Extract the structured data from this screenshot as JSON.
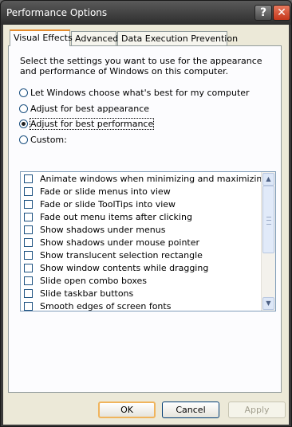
{
  "window": {
    "title": "Performance Options"
  },
  "tabs": [
    "Visual Effects",
    "Advanced",
    "Data Execution Prevention"
  ],
  "description": "Select the settings you want to use for the appearance and performance of Windows on this computer.",
  "options": [
    {
      "label": "Let Windows choose what's best for my computer",
      "checked": false
    },
    {
      "label": "Adjust for best appearance",
      "checked": false
    },
    {
      "label": "Adjust for best performance",
      "checked": true
    },
    {
      "label": "Custom:",
      "checked": false
    }
  ],
  "effects": [
    "Animate windows when minimizing and maximizing",
    "Fade or slide menus into view",
    "Fade or slide ToolTips into view",
    "Fade out menu items after clicking",
    "Show shadows under menus",
    "Show shadows under mouse pointer",
    "Show translucent selection rectangle",
    "Show window contents while dragging",
    "Slide open combo boxes",
    "Slide taskbar buttons",
    "Smooth edges of screen fonts"
  ],
  "buttons": {
    "ok": "OK",
    "cancel": "Cancel",
    "apply": "Apply"
  }
}
